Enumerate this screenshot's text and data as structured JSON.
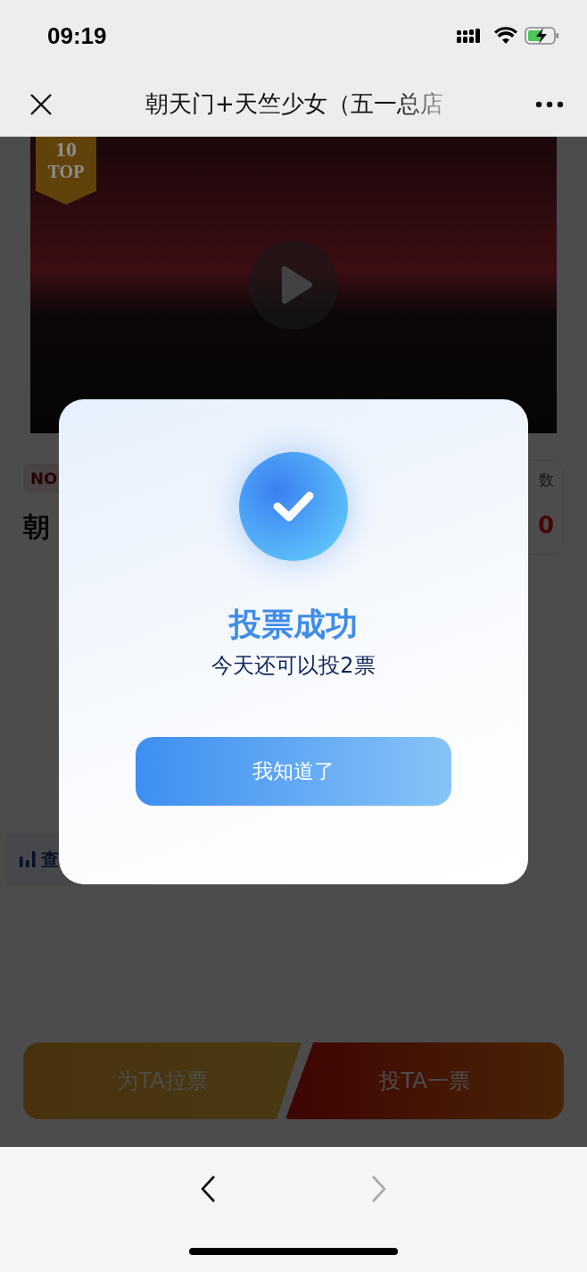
{
  "status_bar": {
    "time": "09:19"
  },
  "nav": {
    "title": "朝天门+天竺少女（五一总店"
  },
  "video": {
    "rank": "10",
    "rank_label": "TOP"
  },
  "entry": {
    "tag": "NO",
    "title": "朝",
    "count_label": "数",
    "count_value": "0"
  },
  "stats_button": {
    "label": "查"
  },
  "actions": [
    {
      "kind": "canvass",
      "label": "为TA拉票"
    },
    {
      "kind": "vote",
      "label": "投TA一票"
    }
  ],
  "dialog": {
    "title": "投票成功",
    "message": "今天还可以投2票",
    "button": "我知道了"
  },
  "browser_nav": [
    {
      "kind": "back",
      "disabled": false
    },
    {
      "kind": "forward",
      "disabled": true
    }
  ]
}
